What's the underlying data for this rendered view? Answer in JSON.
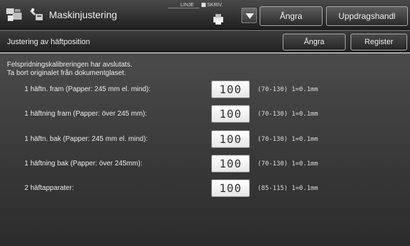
{
  "header": {
    "title": "Maskinjustering",
    "indicator_linje": "LINJE",
    "indicator_skriv": "SKRIV.",
    "undo_label": "Ångra",
    "jobs_label": "Uppdragshandl"
  },
  "subheader": {
    "title": "Justering av häftposition",
    "undo_label": "Ångra",
    "register_label": "Register"
  },
  "message": {
    "line1": "Felspridningskalibreringen har avslutats.",
    "line2": "Ta bort originalet från dokumentglaset."
  },
  "rows": [
    {
      "label": "1 häftn. fram (Papper: 245 mm el. mind):",
      "value": "100",
      "range": "(70-130) 1=0.1mm"
    },
    {
      "label": "1 häftning fram (Papper: över 245 mm):",
      "value": "100",
      "range": "(70-130) 1=0.1mm"
    },
    {
      "label": "1 häftn. bak (Papper: 245 mm el. mind):",
      "value": "100",
      "range": "(70-130) 1=0.1mm"
    },
    {
      "label": "1 häftning bak (Papper: över 245mm):",
      "value": "100",
      "range": "(70-130) 1=0.1mm"
    },
    {
      "label": "2 häftapparater:",
      "value": "100",
      "range": "(85-115) 1=0.1mm"
    }
  ],
  "icons": {
    "home": "copier-home-icon",
    "settings": "machine-settings-icon",
    "printer": "printer-status-icon",
    "dropdown": "chevron-down-icon"
  }
}
